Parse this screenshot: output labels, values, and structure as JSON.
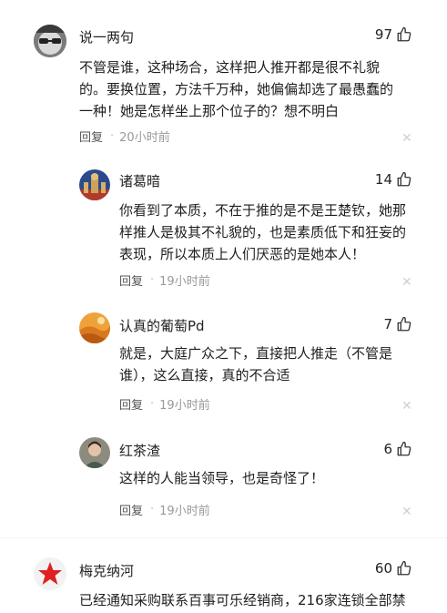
{
  "comments": [
    {
      "username": "说一两句",
      "likes": "97",
      "lines": [
        "不管是谁，这种场合，这样把人推开都是很不礼貌",
        "的。要换位置，方法千万种，她偏偏却选了最愚蠢的",
        "一种！她是怎样坐上那个位子的？想不明白"
      ],
      "reply_label": "回复",
      "time": "20小时前",
      "avatar": "face-glasses-avatar"
    },
    {
      "username": "诸葛暗",
      "likes": "14",
      "lines": [
        "你看到了本质，不在于推的是不是王楚钦，她那",
        "样推人是极其不礼貌的，也是素质低下和狂妄的",
        "表现，所以本质上人们厌恶的是她本人！"
      ],
      "reply_label": "回复",
      "time": "19小时前",
      "avatar": "statue-avatar"
    },
    {
      "username": "认真的葡萄Pd",
      "likes": "7",
      "lines": [
        "就是，大庭广众之下，直接把人推走（不管是",
        "谁），这么直接，真的不合适"
      ],
      "reply_label": "回复",
      "time": "19小时前",
      "avatar": "desert-dune-avatar"
    },
    {
      "username": "红茶渣",
      "likes": "6",
      "lines": [
        "这样的人能当领导，也是奇怪了！"
      ],
      "reply_label": "回复",
      "time": "19小时前",
      "avatar": "portrait-avatar"
    },
    {
      "username": "梅克纳河",
      "likes": "60",
      "lines": [
        "已经通知采购联系百事可乐经销商，216家连锁全部禁"
      ],
      "avatar": "red-star-avatar"
    }
  ],
  "icons": {
    "like": "thumbs-up-icon",
    "close": "close-icon"
  },
  "colors": {
    "meta": "#999999",
    "star": "#e02020"
  }
}
